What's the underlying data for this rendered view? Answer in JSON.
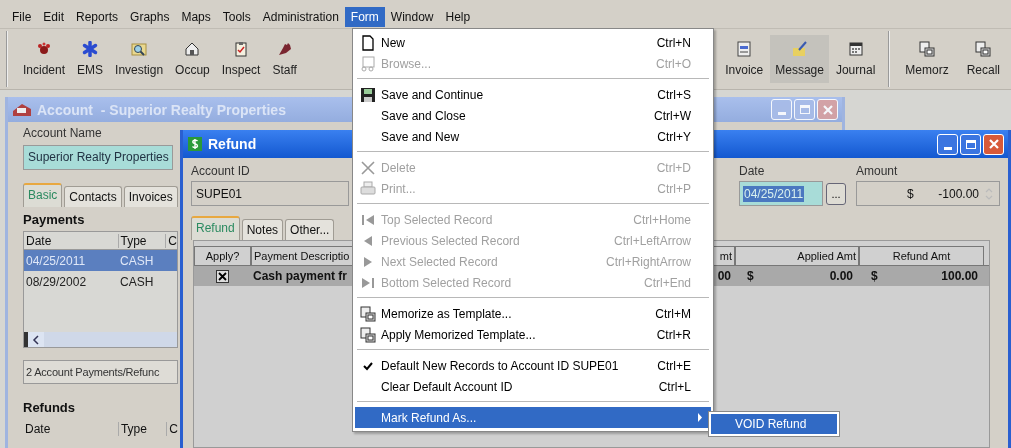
{
  "menu_bar": [
    {
      "label": "File",
      "selected": false
    },
    {
      "label": "Edit",
      "selected": false
    },
    {
      "label": "Reports",
      "selected": false
    },
    {
      "label": "Graphs",
      "selected": false
    },
    {
      "label": "Maps",
      "selected": false
    },
    {
      "label": "Tools",
      "selected": false
    },
    {
      "label": "Administration",
      "selected": false
    },
    {
      "label": "Form",
      "selected": true
    },
    {
      "label": "Window",
      "selected": false
    },
    {
      "label": "Help",
      "selected": false
    }
  ],
  "toolbar": [
    {
      "items": [
        {
          "label": "Incident",
          "highlighted": false
        },
        {
          "label": "EMS",
          "highlighted": false
        },
        {
          "label": "Investign",
          "highlighted": false
        },
        {
          "label": "Occup",
          "highlighted": false
        },
        {
          "label": "Inspect",
          "highlighted": false
        },
        {
          "label": "Staff",
          "highlighted": false
        }
      ]
    },
    {
      "items": [
        {
          "label": "Invoice",
          "highlighted": false
        },
        {
          "label": "Message",
          "highlighted": true
        },
        {
          "label": "Journal",
          "highlighted": false
        }
      ]
    },
    {
      "items": [
        {
          "label": "Memorz",
          "highlighted": false
        },
        {
          "label": "Recall",
          "highlighted": false
        }
      ]
    }
  ],
  "account_window": {
    "title": "Account  - Superior Realty Properties",
    "active": false,
    "account_name_label": "Account Name",
    "account_name": "Superior Realty Properties",
    "tabs": [
      {
        "label": "Basic",
        "selected": true
      },
      {
        "label": "Contacts",
        "selected": false
      },
      {
        "label": "Invoices",
        "selected": false
      }
    ],
    "payments": {
      "heading": "Payments",
      "columns": [
        "Date",
        "Type",
        "C"
      ],
      "rows": [
        {
          "cells": [
            "04/25/2011",
            "CASH"
          ],
          "selected": true
        },
        {
          "cells": [
            "08/29/2002",
            "CASH"
          ],
          "selected": false
        }
      ],
      "status": "2 Account Payments/Refunc"
    },
    "refunds": {
      "heading": "Refunds",
      "columns": [
        "Date",
        "Type",
        "C"
      ]
    }
  },
  "refund_window": {
    "title": "Refund",
    "active": true,
    "account_id_label": "Account ID",
    "account_id": "SUPE01",
    "date_label": "Date",
    "date": "04/25/2011",
    "date_text_selected": true,
    "date_button": "...",
    "amount_label": "Amount",
    "amount_currency": "$",
    "amount": "-100.00",
    "tabs": [
      {
        "label": "Refund",
        "selected": true
      },
      {
        "label": "Notes",
        "selected": false
      },
      {
        "label": "Other...",
        "selected": false
      }
    ],
    "grid": {
      "columns": [
        "Apply?",
        "Payment Descriptio",
        "mt",
        "Applied Amt",
        "Refund Amt"
      ],
      "rows": [
        {
          "apply": true,
          "selected": true,
          "description": "Cash payment fr",
          "column_3": "00",
          "applied_currency": "$",
          "applied_amt": "0.00",
          "refund_currency": "$",
          "refund_amt": "100.00"
        }
      ]
    }
  },
  "form_menu": {
    "items": [
      {
        "kind": "item",
        "label": "New",
        "shortcut": "Ctrl+N",
        "disabled": false,
        "checked": false,
        "selected": false
      },
      {
        "kind": "item",
        "label": "Browse...",
        "shortcut": "Ctrl+O",
        "disabled": true,
        "checked": false,
        "selected": false
      },
      {
        "kind": "separator"
      },
      {
        "kind": "item",
        "label": "Save and Continue",
        "shortcut": "Ctrl+S",
        "disabled": false,
        "checked": false,
        "selected": false
      },
      {
        "kind": "item",
        "label": "Save and Close",
        "shortcut": "Ctrl+W",
        "disabled": false,
        "checked": false,
        "selected": false
      },
      {
        "kind": "item",
        "label": "Save and New",
        "shortcut": "Ctrl+Y",
        "disabled": false,
        "checked": false,
        "selected": false
      },
      {
        "kind": "separator"
      },
      {
        "kind": "item",
        "label": "Delete",
        "shortcut": "Ctrl+D",
        "disabled": true,
        "checked": false,
        "selected": false
      },
      {
        "kind": "item",
        "label": "Print...",
        "shortcut": "Ctrl+P",
        "disabled": true,
        "checked": false,
        "selected": false
      },
      {
        "kind": "separator"
      },
      {
        "kind": "item",
        "label": "Top Selected Record",
        "shortcut": "Ctrl+Home",
        "disabled": true,
        "checked": false,
        "selected": false
      },
      {
        "kind": "item",
        "label": "Previous Selected Record",
        "shortcut": "Ctrl+LeftArrow",
        "disabled": true,
        "checked": false,
        "selected": false
      },
      {
        "kind": "item",
        "label": "Next Selected Record",
        "shortcut": "Ctrl+RightArrow",
        "disabled": true,
        "checked": false,
        "selected": false
      },
      {
        "kind": "item",
        "label": "Bottom Selected Record",
        "shortcut": "Ctrl+End",
        "disabled": true,
        "checked": false,
        "selected": false
      },
      {
        "kind": "separator"
      },
      {
        "kind": "item",
        "label": "Memorize as Template...",
        "shortcut": "Ctrl+M",
        "disabled": false,
        "checked": false,
        "selected": false
      },
      {
        "kind": "item",
        "label": "Apply Memorized Template...",
        "shortcut": "Ctrl+R",
        "disabled": false,
        "checked": false,
        "selected": false
      },
      {
        "kind": "separator"
      },
      {
        "kind": "item",
        "label": "Default New Records to Account ID SUPE01",
        "shortcut": "Ctrl+E",
        "disabled": false,
        "checked": true,
        "selected": false
      },
      {
        "kind": "item",
        "label": "Clear Default Account ID",
        "shortcut": "Ctrl+L",
        "disabled": false,
        "checked": false,
        "selected": false
      },
      {
        "kind": "separator"
      },
      {
        "kind": "submenu",
        "label": "Mark Refund As...",
        "disabled": false,
        "checked": false,
        "selected": true
      }
    ]
  },
  "submenu": {
    "items": [
      {
        "label": "VOID Refund",
        "selected": true
      }
    ]
  }
}
